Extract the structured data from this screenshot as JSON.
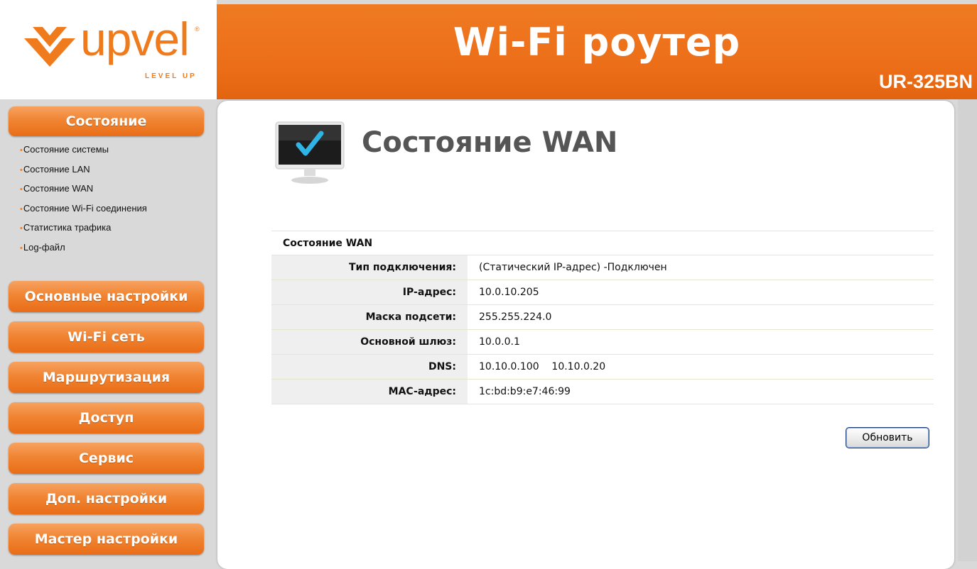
{
  "brand": {
    "logo_text": "upvel",
    "logo_tagline": "LEVEL UP",
    "logo_reg": "®",
    "accent_color": "#f07b1d"
  },
  "header": {
    "title": "Wi-Fi роутер",
    "model": "UR-325BN"
  },
  "sidebar": {
    "status_label": "Состояние",
    "status_items": [
      "Состояние системы",
      "Состояние LAN",
      "Состояние WAN",
      "Состояние Wi-Fi соединения",
      "Статистика трафика",
      "Log-файл"
    ],
    "menu": [
      "Основные настройки",
      "Wi-Fi сеть",
      "Маршрутизация",
      "Доступ",
      "Сервис",
      "Доп. настройки",
      "Мастер настройки"
    ]
  },
  "main": {
    "page_title": "Состояние WAN",
    "page_icon": "monitor-check-icon",
    "table_caption": "Состояние WAN",
    "rows": [
      {
        "label": "Тип подключения:",
        "value": "(Статический IP-адрес) -Подключен"
      },
      {
        "label": "IP-адрес:",
        "value": "10.0.10.205"
      },
      {
        "label": "Маска подсети:",
        "value": "255.255.224.0"
      },
      {
        "label": "Основной шлюз:",
        "value": "10.0.0.1"
      },
      {
        "label": "DNS:",
        "value": "10.10.0.100    10.10.0.20"
      },
      {
        "label": "MAC-адрес:",
        "value": "1c:bd:b9:e7:46:99"
      }
    ],
    "refresh_label": "Обновить"
  }
}
